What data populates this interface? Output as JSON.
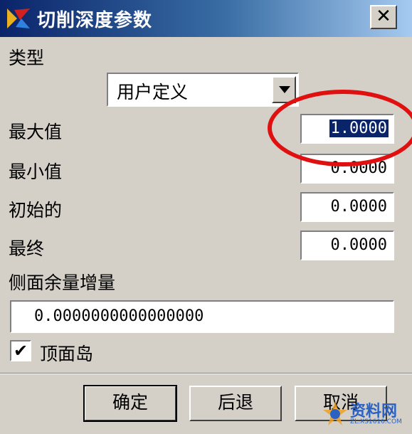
{
  "window": {
    "title": "切削深度参数",
    "close_label": "✕"
  },
  "fields": {
    "type_label": "类型",
    "type_value": "用户定义",
    "max_label": "最大值",
    "max_value": "1.0000",
    "min_label": "最小值",
    "min_value": "0.0000",
    "initial_label": "初始的",
    "initial_value": "0.0000",
    "final_label": "最终",
    "final_value": "0.0000",
    "side_stock_label": "侧面余量增量",
    "side_stock_value": "0.0000000000000000",
    "top_island_label": "顶面岛",
    "top_island_checked": true,
    "check_mark": "✔"
  },
  "buttons": {
    "ok": "确定",
    "back": "后退",
    "cancel": "取消"
  },
  "watermark": {
    "main": "资料网",
    "sub": "ZL.XS1616.COM"
  },
  "colors": {
    "title_bar": "#0a246a",
    "dialog_bg": "#d4d0c8",
    "selection": "#0a246a",
    "annotation": "#e01010"
  },
  "icons": [
    "app-icon",
    "close-icon",
    "dropdown-arrow-icon",
    "checkbox-check-icon",
    "watermark-logo-icon"
  ]
}
